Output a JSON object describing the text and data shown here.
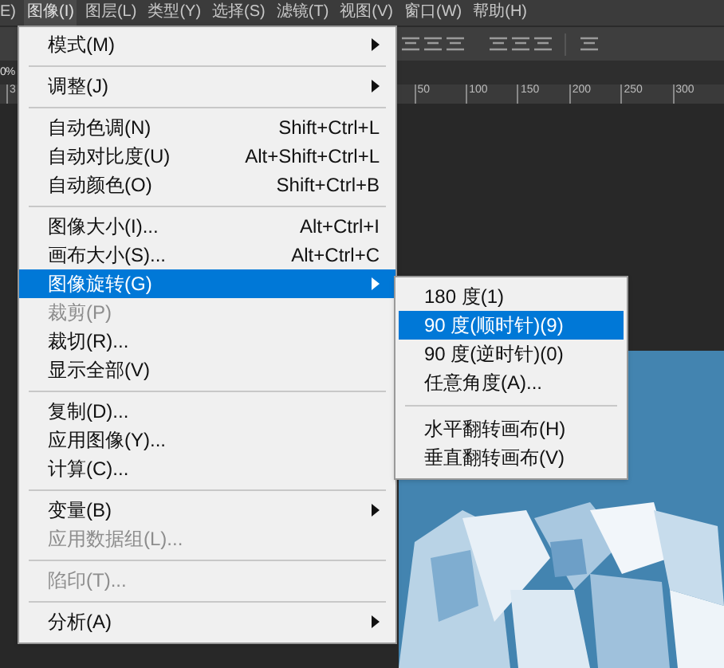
{
  "menubar": {
    "items": [
      {
        "label": "E)",
        "selected": false
      },
      {
        "label": "图像(I)",
        "selected": true
      },
      {
        "label": "图层(L)",
        "selected": false
      },
      {
        "label": "类型(Y)",
        "selected": false
      },
      {
        "label": "选择(S)",
        "selected": false
      },
      {
        "label": "滤镜(T)",
        "selected": false
      },
      {
        "label": "视图(V)",
        "selected": false
      },
      {
        "label": "窗口(W)",
        "selected": false
      },
      {
        "label": "帮助(H)",
        "selected": false
      }
    ]
  },
  "document_tab": {
    "label": "0%"
  },
  "ruler": {
    "labels": [
      "3",
      "50",
      "100",
      "150",
      "200",
      "250",
      "300"
    ]
  },
  "menu": {
    "items": [
      {
        "kind": "item",
        "label": "模式(M)",
        "submenu": true,
        "disabled": false,
        "selected": false
      },
      {
        "kind": "separator"
      },
      {
        "kind": "item",
        "label": "调整(J)",
        "submenu": true,
        "disabled": false,
        "selected": false
      },
      {
        "kind": "separator"
      },
      {
        "kind": "item",
        "label": "自动色调(N)",
        "shortcut": "Shift+Ctrl+L",
        "submenu": false,
        "disabled": false,
        "selected": false
      },
      {
        "kind": "item",
        "label": "自动对比度(U)",
        "shortcut": "Alt+Shift+Ctrl+L",
        "submenu": false,
        "disabled": false,
        "selected": false
      },
      {
        "kind": "item",
        "label": "自动颜色(O)",
        "shortcut": "Shift+Ctrl+B",
        "submenu": false,
        "disabled": false,
        "selected": false
      },
      {
        "kind": "separator"
      },
      {
        "kind": "item",
        "label": "图像大小(I)...",
        "shortcut": "Alt+Ctrl+I",
        "submenu": false,
        "disabled": false,
        "selected": false
      },
      {
        "kind": "item",
        "label": "画布大小(S)...",
        "shortcut": "Alt+Ctrl+C",
        "submenu": false,
        "disabled": false,
        "selected": false
      },
      {
        "kind": "item",
        "label": "图像旋转(G)",
        "submenu": true,
        "disabled": false,
        "selected": true
      },
      {
        "kind": "item",
        "label": "裁剪(P)",
        "submenu": false,
        "disabled": true,
        "selected": false
      },
      {
        "kind": "item",
        "label": "裁切(R)...",
        "submenu": false,
        "disabled": false,
        "selected": false
      },
      {
        "kind": "item",
        "label": "显示全部(V)",
        "submenu": false,
        "disabled": false,
        "selected": false
      },
      {
        "kind": "separator"
      },
      {
        "kind": "item",
        "label": "复制(D)...",
        "submenu": false,
        "disabled": false,
        "selected": false
      },
      {
        "kind": "item",
        "label": "应用图像(Y)...",
        "submenu": false,
        "disabled": false,
        "selected": false
      },
      {
        "kind": "item",
        "label": "计算(C)...",
        "submenu": false,
        "disabled": false,
        "selected": false
      },
      {
        "kind": "separator"
      },
      {
        "kind": "item",
        "label": "变量(B)",
        "submenu": true,
        "disabled": false,
        "selected": false
      },
      {
        "kind": "item",
        "label": "应用数据组(L)...",
        "submenu": false,
        "disabled": true,
        "selected": false
      },
      {
        "kind": "separator"
      },
      {
        "kind": "item",
        "label": "陷印(T)...",
        "submenu": false,
        "disabled": true,
        "selected": false
      },
      {
        "kind": "separator"
      },
      {
        "kind": "item",
        "label": "分析(A)",
        "submenu": true,
        "disabled": false,
        "selected": false
      }
    ]
  },
  "submenu": {
    "items": [
      {
        "kind": "item",
        "label": "180 度(1)",
        "selected": false
      },
      {
        "kind": "item",
        "label": "90 度(顺时针)(9)",
        "selected": true
      },
      {
        "kind": "item",
        "label": "90 度(逆时针)(0)",
        "selected": false
      },
      {
        "kind": "item",
        "label": "任意角度(A)...",
        "selected": false
      },
      {
        "kind": "separator"
      },
      {
        "kind": "item",
        "label": "水平翻转画布(H)",
        "selected": false
      },
      {
        "kind": "item",
        "label": "垂直翻转画布(V)",
        "selected": false
      }
    ]
  }
}
